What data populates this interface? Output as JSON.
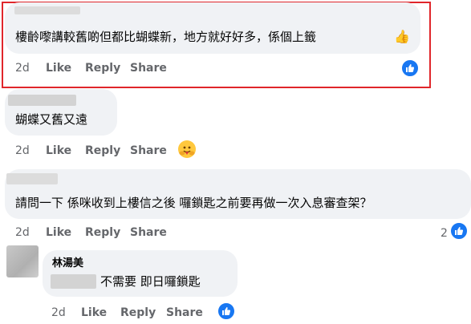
{
  "actions": {
    "time": "2d",
    "like": "Like",
    "reply": "Reply",
    "share": "Share"
  },
  "comments": [
    {
      "text": "樓齡嚟講較舊啲但都比蝴蝶新，地方就好好多，係個上籤",
      "emoji": "thumbs-up"
    },
    {
      "text": "蝴蝶又舊又遠",
      "emoji": "hugging-face"
    },
    {
      "text": "請問一下 係咪收到上樓信之後 囉鎖匙之前要再做一次入息審查架？",
      "reaction_count": "2"
    },
    {
      "author": "林湯美",
      "text": "不需要 即日囉鎖匙"
    }
  ],
  "colors": {
    "like_blue": "#1877f2",
    "highlight_red": "#e0262b",
    "bubble": "#f0f2f5"
  }
}
